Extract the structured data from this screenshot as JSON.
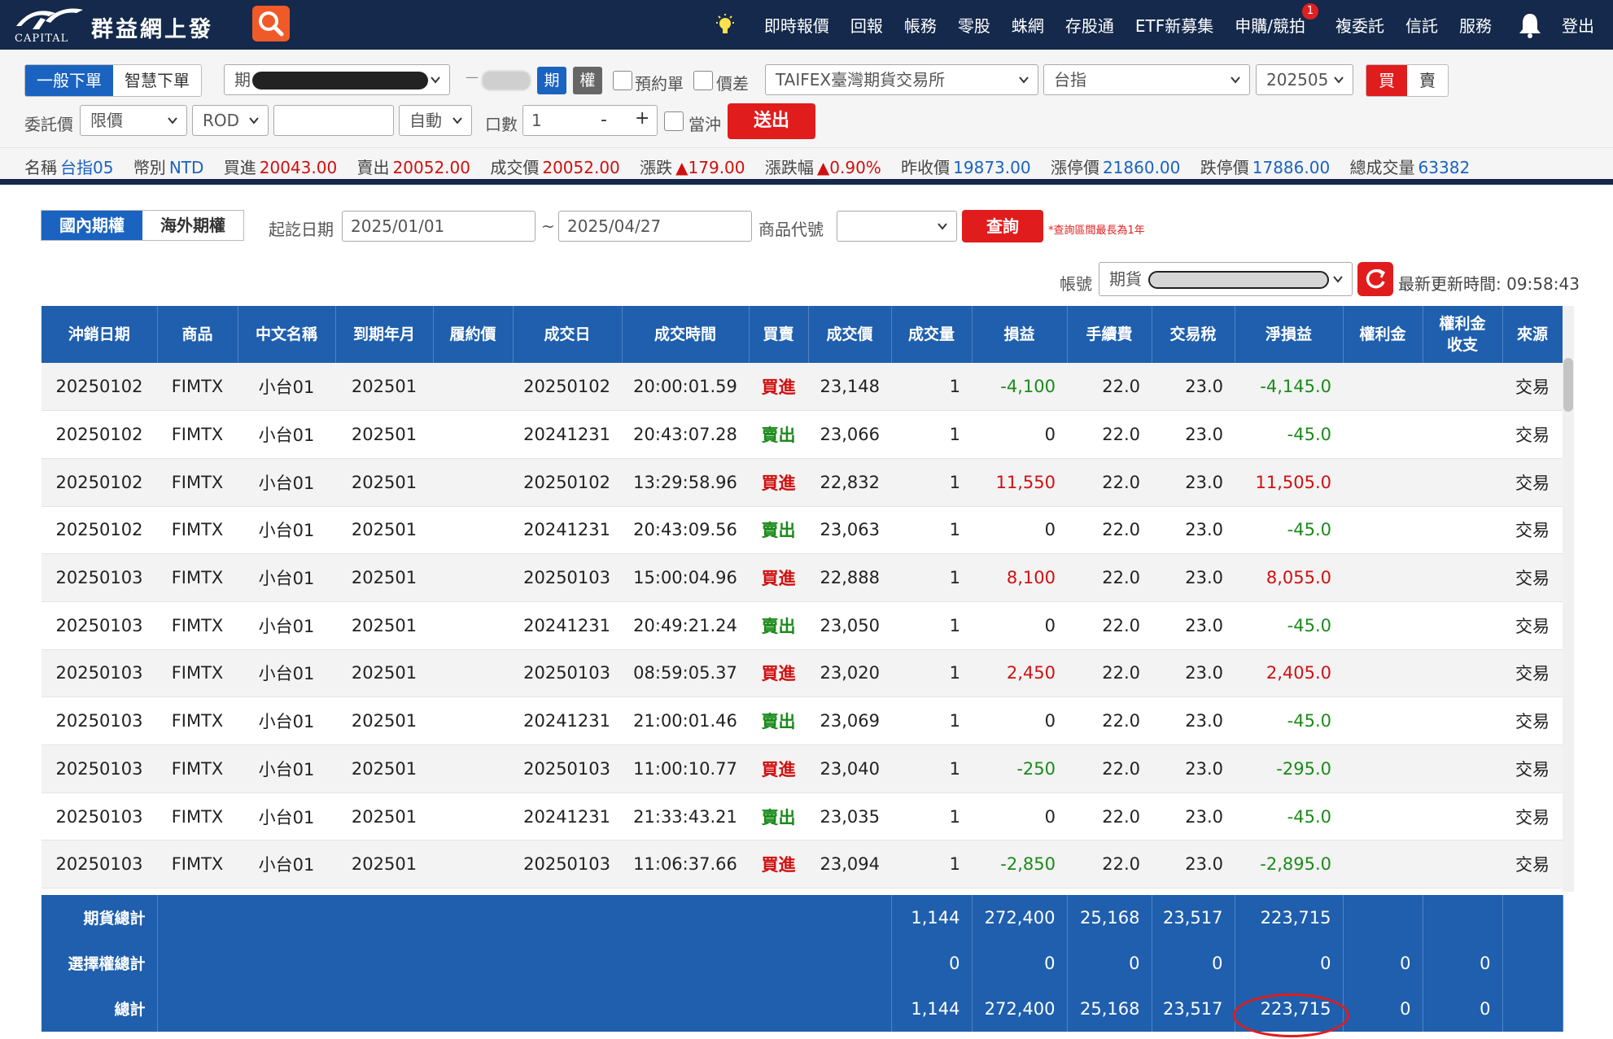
{
  "navbar": {
    "logo_text": "CAPITAL",
    "brand": "群益網上發",
    "items": [
      "即時報價",
      "回報",
      "帳務",
      "零股",
      "蛛網",
      "存股通",
      "ETF新募集",
      "申購/競拍",
      "複委託",
      "信託",
      "服務"
    ],
    "badge_count": "1",
    "logout": "登出"
  },
  "order": {
    "tab_normal": "一般下單",
    "tab_smart": "智慧下單",
    "account_prefix": "期",
    "dash": "—",
    "type_futures": "期",
    "type_options": "權",
    "reserve_label": "預約單",
    "spread_label": "價差",
    "exchange": "TAIFEX臺灣期貨交易所",
    "product": "台指",
    "month": "202505",
    "buy": "買",
    "sell": "賣",
    "price_type_label": "委託價",
    "price_type": "限價",
    "condition": "ROD",
    "price_value": "",
    "auto": "自動",
    "qty_label": "口數",
    "qty": "1",
    "minus": "-",
    "plus": "+",
    "daytrade_label": "當沖",
    "submit": "送出"
  },
  "quote": {
    "name_label": "名稱",
    "name": "台指05",
    "currency_label": "幣別",
    "currency": "NTD",
    "bid_label": "買進",
    "bid": "20043.00",
    "ask_label": "賣出",
    "ask": "20052.00",
    "last_label": "成交價",
    "last": "20052.00",
    "chg_label": "漲跌",
    "chg": "▲179.00",
    "chgpct_label": "漲跌幅",
    "chgpct": "▲0.90%",
    "prev_label": "昨收價",
    "prev": "19873.00",
    "limitup_label": "漲停價",
    "limitup": "21860.00",
    "limitdown_label": "跌停價",
    "limitdown": "17886.00",
    "volume_label": "總成交量",
    "volume": "63382"
  },
  "query": {
    "tab_domestic": "國內期權",
    "tab_foreign": "海外期權",
    "date_label": "起訖日期",
    "date_from": "2025/01/01",
    "tilde": "~",
    "date_to": "2025/04/27",
    "code_label": "商品代號",
    "code_value": "",
    "search": "查詢",
    "note": "*查詢區間最長為1年",
    "account_label": "帳號",
    "account_prefix": "期貨",
    "updated_label": "最新更新時間:",
    "updated_time": "09:58:43"
  },
  "table": {
    "headers": [
      "沖銷日期",
      "商品",
      "中文名稱",
      "到期年月",
      "履約價",
      "成交日",
      "成交時間",
      "買賣",
      "成交價",
      "成交量",
      "損益",
      "手續費",
      "交易稅",
      "淨損益",
      "權利金",
      "權利金收支",
      "來源"
    ],
    "rows": [
      [
        "20250102",
        "FIMTX",
        "小台01",
        "202501",
        "",
        "20250102",
        "20:00:01.59",
        "買進",
        "23,148",
        "1",
        "-4,100",
        "22.0",
        "23.0",
        "-4,145.0",
        "",
        "",
        "交易"
      ],
      [
        "20250102",
        "FIMTX",
        "小台01",
        "202501",
        "",
        "20241231",
        "20:43:07.28",
        "賣出",
        "23,066",
        "1",
        "0",
        "22.0",
        "23.0",
        "-45.0",
        "",
        "",
        "交易"
      ],
      [
        "20250102",
        "FIMTX",
        "小台01",
        "202501",
        "",
        "20250102",
        "13:29:58.96",
        "買進",
        "22,832",
        "1",
        "11,550",
        "22.0",
        "23.0",
        "11,505.0",
        "",
        "",
        "交易"
      ],
      [
        "20250102",
        "FIMTX",
        "小台01",
        "202501",
        "",
        "20241231",
        "20:43:09.56",
        "賣出",
        "23,063",
        "1",
        "0",
        "22.0",
        "23.0",
        "-45.0",
        "",
        "",
        "交易"
      ],
      [
        "20250103",
        "FIMTX",
        "小台01",
        "202501",
        "",
        "20250103",
        "15:00:04.96",
        "買進",
        "22,888",
        "1",
        "8,100",
        "22.0",
        "23.0",
        "8,055.0",
        "",
        "",
        "交易"
      ],
      [
        "20250103",
        "FIMTX",
        "小台01",
        "202501",
        "",
        "20241231",
        "20:49:21.24",
        "賣出",
        "23,050",
        "1",
        "0",
        "22.0",
        "23.0",
        "-45.0",
        "",
        "",
        "交易"
      ],
      [
        "20250103",
        "FIMTX",
        "小台01",
        "202501",
        "",
        "20250103",
        "08:59:05.37",
        "買進",
        "23,020",
        "1",
        "2,450",
        "22.0",
        "23.0",
        "2,405.0",
        "",
        "",
        "交易"
      ],
      [
        "20250103",
        "FIMTX",
        "小台01",
        "202501",
        "",
        "20241231",
        "21:00:01.46",
        "賣出",
        "23,069",
        "1",
        "0",
        "22.0",
        "23.0",
        "-45.0",
        "",
        "",
        "交易"
      ],
      [
        "20250103",
        "FIMTX",
        "小台01",
        "202501",
        "",
        "20250103",
        "11:00:10.77",
        "買進",
        "23,040",
        "1",
        "-250",
        "22.0",
        "23.0",
        "-295.0",
        "",
        "",
        "交易"
      ],
      [
        "20250103",
        "FIMTX",
        "小台01",
        "202501",
        "",
        "20241231",
        "21:33:43.21",
        "賣出",
        "23,035",
        "1",
        "0",
        "22.0",
        "23.0",
        "-45.0",
        "",
        "",
        "交易"
      ],
      [
        "20250103",
        "FIMTX",
        "小台01",
        "202501",
        "",
        "20250103",
        "11:06:37.66",
        "買進",
        "23,094",
        "1",
        "-2,850",
        "22.0",
        "23.0",
        "-2,895.0",
        "",
        "",
        "交易"
      ]
    ],
    "totals": [
      {
        "label": "期貨總計",
        "qty": "1,144",
        "pnl": "272,400",
        "fee": "25,168",
        "tax": "23,517",
        "net": "223,715",
        "premium": "",
        "premium_flow": ""
      },
      {
        "label": "選擇權總計",
        "qty": "0",
        "pnl": "0",
        "fee": "0",
        "tax": "0",
        "net": "0",
        "premium": "0",
        "premium_flow": "0"
      },
      {
        "label": "總計",
        "qty": "1,144",
        "pnl": "272,400",
        "fee": "25,168",
        "tax": "23,517",
        "net": "223,715",
        "premium": "0",
        "premium_flow": "0"
      }
    ]
  },
  "colors": {
    "navy": "#14294b",
    "header_blue": "#1f5fad",
    "accent_blue": "#1a63c0",
    "red": "#e11c1c",
    "green": "#1b8a1b"
  }
}
